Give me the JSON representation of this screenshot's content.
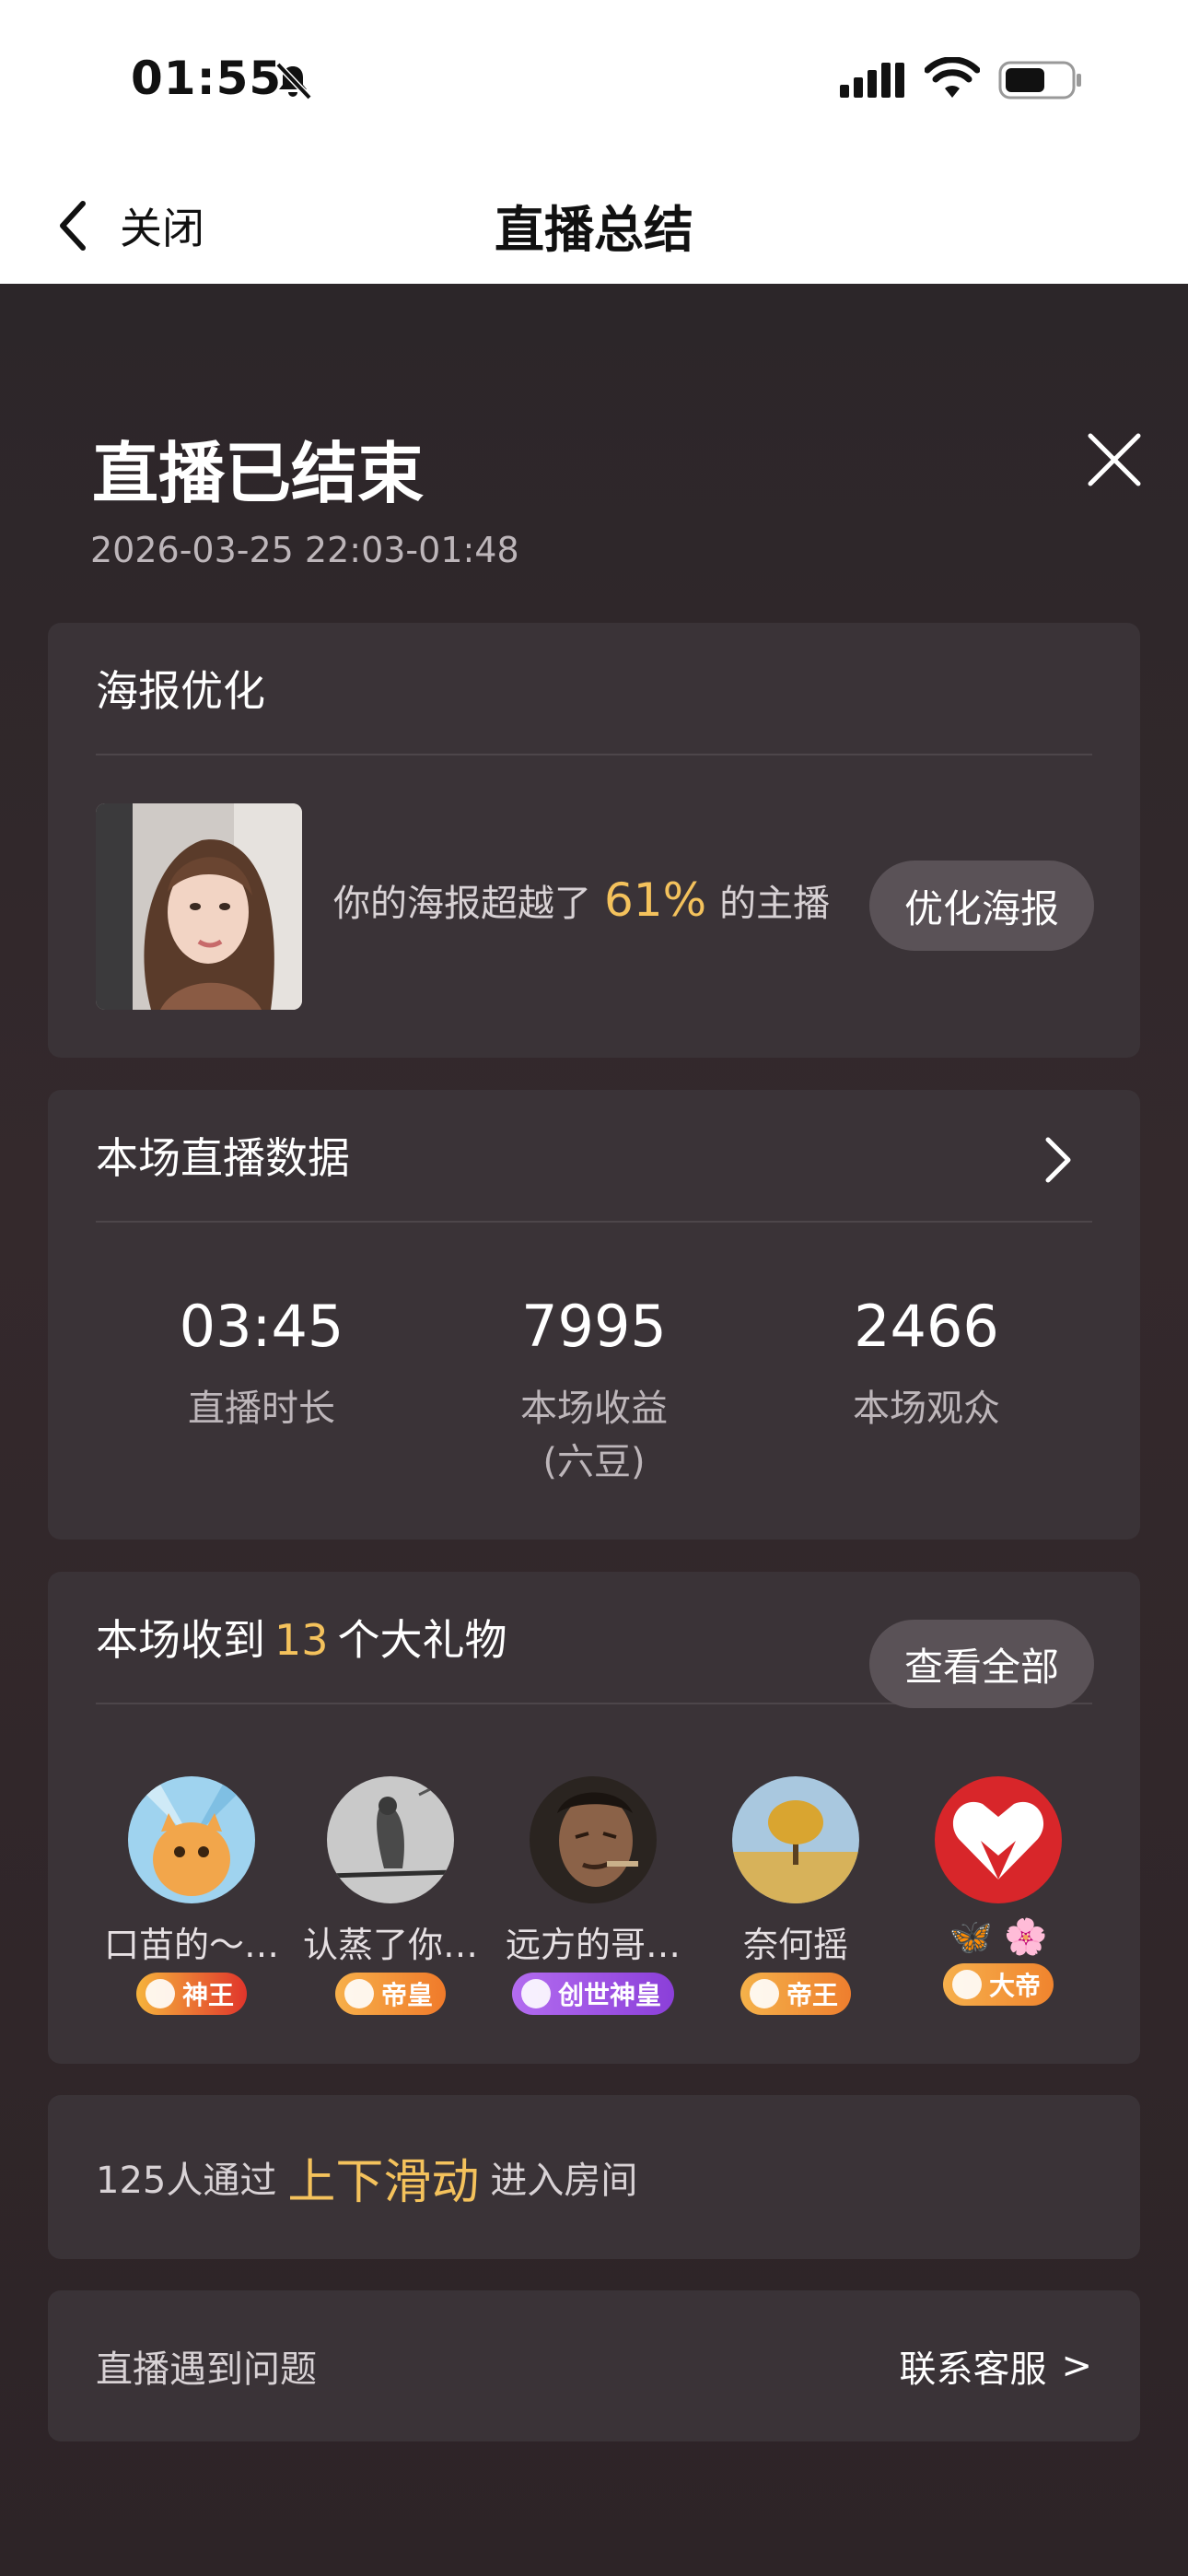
{
  "status_bar": {
    "time": "01:55"
  },
  "nav": {
    "back_label": "关闭",
    "title": "直播总结"
  },
  "summary": {
    "title": "直播已结束",
    "time_range": "2026-03-25 22:03-01:48"
  },
  "poster_card": {
    "header": "海报优化",
    "text_before": "你的海报超越了",
    "percent": "61%",
    "text_after": "的主播",
    "button": "优化海报"
  },
  "stats_card": {
    "header": "本场直播数据",
    "items": [
      {
        "value": "03:45",
        "label": "直播时长"
      },
      {
        "value": "7995",
        "label": "本场收益\n(六豆)"
      },
      {
        "value": "2466",
        "label": "本场观众"
      }
    ]
  },
  "gifts_card": {
    "text_before": "本场收到",
    "count": "13",
    "text_after": "个大礼物",
    "button": "查看全部",
    "gifters": [
      {
        "name": "口苗的～…",
        "badge": "神王",
        "badge_color": "#e0352b",
        "avatar": "cat"
      },
      {
        "name": "认蒸了你…",
        "badge": "帝皇",
        "badge_color": "#f07a2a",
        "avatar": "bird"
      },
      {
        "name": "远方的哥…",
        "badge": "创世神皇",
        "badge_color": "#8b3fd9",
        "avatar": "man"
      },
      {
        "name": "奈何摇",
        "badge": "帝王",
        "badge_color": "#ee7e2e",
        "avatar": "tree"
      },
      {
        "name": "🦋 🌸",
        "badge": "大帝",
        "badge_color": "#f0842e",
        "avatar": "heart"
      }
    ]
  },
  "swipe_card": {
    "text_before": "125人通过",
    "highlight": "上下滑动",
    "text_after": "进入房间"
  },
  "issue_card": {
    "label": "直播遇到问题",
    "link": "联系客服",
    "chevron": ">"
  },
  "colors": {
    "accent": "#f4c25c",
    "card": "#3a3337",
    "background": "#2c2629"
  }
}
